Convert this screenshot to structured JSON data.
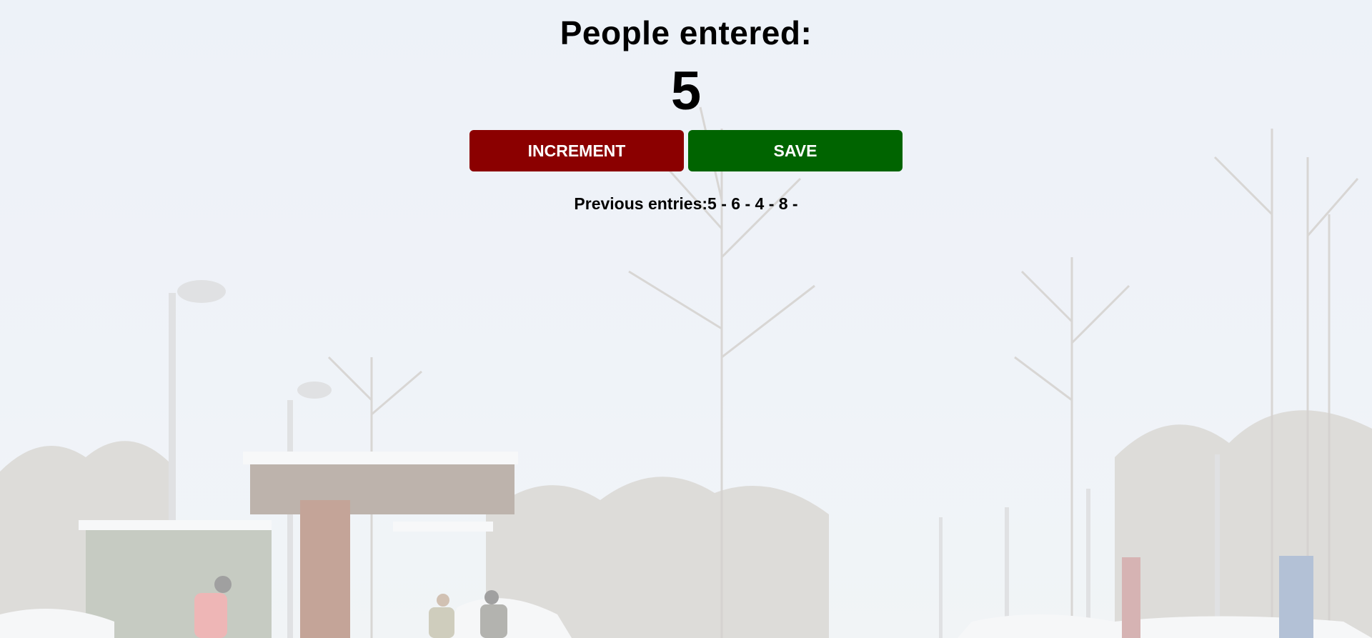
{
  "app": {
    "title": "People entered:",
    "count": "5"
  },
  "buttons": {
    "increment_label": "INCREMENT",
    "save_label": "SAVE"
  },
  "entries": {
    "label": "Previous entries:",
    "values": "5 - 6 - 4 - 8 -"
  },
  "colors": {
    "increment": "#8b0000",
    "save": "#006400",
    "background_tint": "#e8eef6"
  },
  "background": {
    "scene": "snowy-train-station-with-bare-birch-trees"
  }
}
